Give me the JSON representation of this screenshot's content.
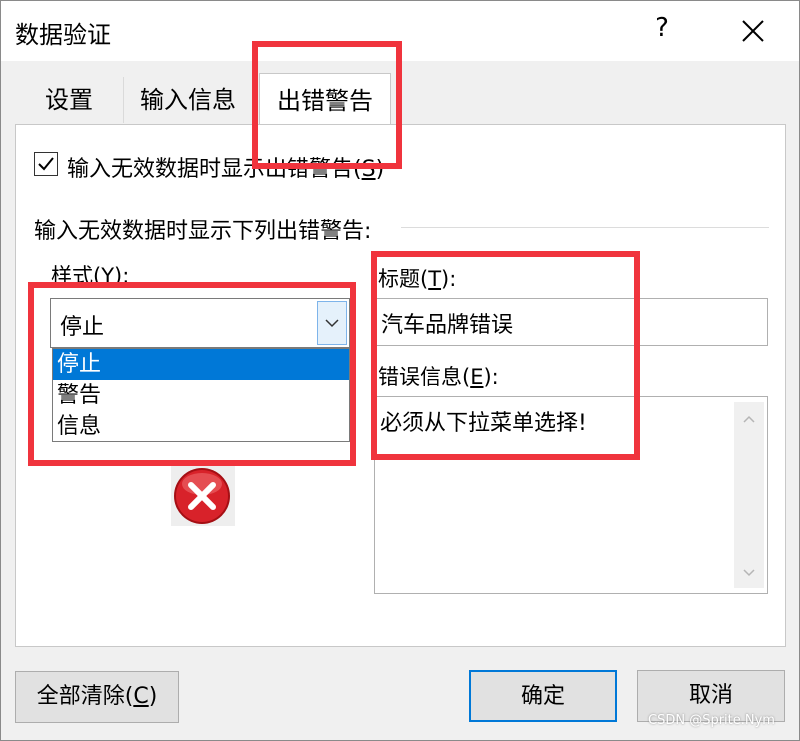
{
  "dialog": {
    "title": "数据验证",
    "help_glyph": "?"
  },
  "tabs": [
    {
      "label": "设置",
      "active": false
    },
    {
      "label": "输入信息",
      "active": false
    },
    {
      "label": "出错警告",
      "active": true
    }
  ],
  "error_alert": {
    "show_checkbox": {
      "checked": true,
      "label": "输入无效数据时显示出错警告(",
      "accesskey": "S",
      "label_end": ")"
    },
    "section_label": "输入无效数据时显示下列出错警告:",
    "style": {
      "label": "样式(Y):",
      "selected": "停止",
      "options": [
        "停止",
        "警告",
        "信息"
      ],
      "highlighted_option": "停止",
      "icon": "stop-error-icon"
    },
    "title": {
      "label_prefix": "标题(",
      "accesskey": "T",
      "label_suffix": "):",
      "value": "汽车品牌错误"
    },
    "error_message": {
      "label_prefix": "错误信息(",
      "accesskey": "E",
      "label_suffix": "):",
      "value": "必须从下拉菜单选择!"
    }
  },
  "buttons": {
    "clear_prefix": "全部清除(",
    "clear_accesskey": "C",
    "clear_suffix": ")",
    "ok": "确定",
    "cancel": "取消"
  },
  "watermark": "CSDN @Sprite.Nym",
  "colors": {
    "highlight_box": "#f0343d",
    "selection": "#0078d7",
    "stop_icon": "#c8161d"
  }
}
